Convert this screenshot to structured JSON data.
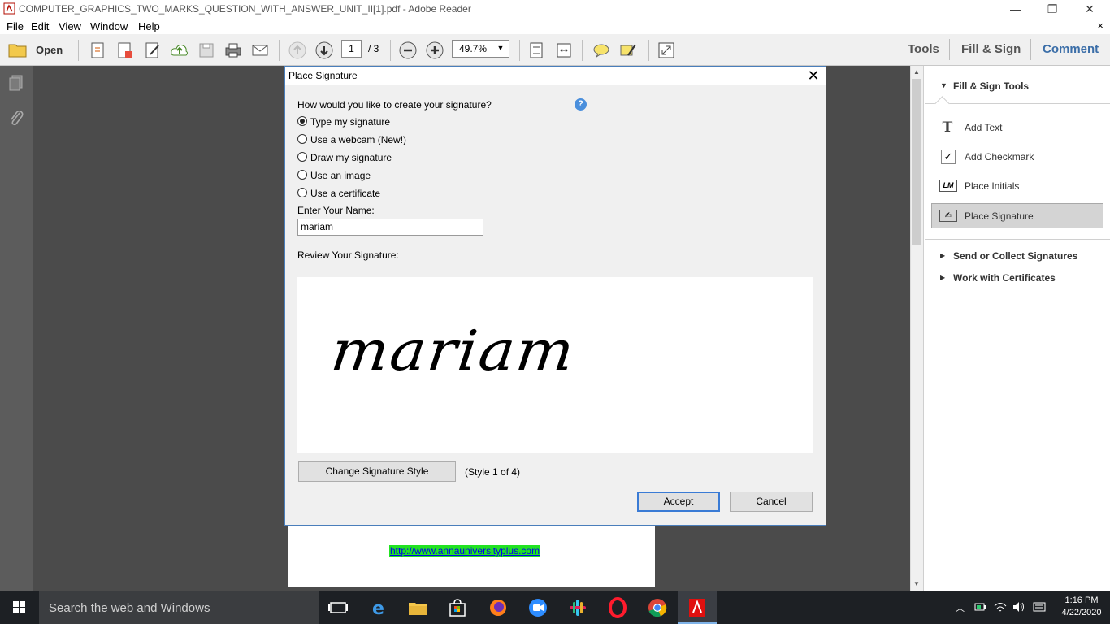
{
  "window": {
    "title": "COMPUTER_GRAPHICS_TWO_MARKS_QUESTION_WITH_ANSWER_UNIT_II[1].pdf - Adobe Reader",
    "minimize": "—",
    "restore": "❐",
    "close": "✕"
  },
  "menu": {
    "items": [
      "File",
      "Edit",
      "View",
      "Window",
      "Help"
    ],
    "close": "×"
  },
  "toolbar": {
    "open_label": "Open",
    "page_current": "1",
    "page_total": "/ 3",
    "zoom": "49.7%",
    "tabs": [
      "Tools",
      "Fill & Sign",
      "Comment"
    ]
  },
  "document": {
    "link": "http://www.annauniversityplus.com"
  },
  "right_panel": {
    "section_title": "Fill & Sign Tools",
    "items": [
      {
        "label": "Add Text",
        "icon": "T"
      },
      {
        "label": "Add Checkmark",
        "icon": "✓"
      },
      {
        "label": "Place Initials",
        "icon": "LM"
      },
      {
        "label": "Place Signature",
        "icon": "✍"
      }
    ],
    "collapsed_sections": [
      "Send or Collect Signatures",
      "Work with Certificates"
    ]
  },
  "dialog": {
    "title": "Place Signature",
    "question": "How would you like to create your signature?",
    "options": [
      {
        "label": "Type my signature",
        "selected": true
      },
      {
        "label": "Use a webcam (New!)",
        "selected": false
      },
      {
        "label": "Draw my signature",
        "selected": false
      },
      {
        "label": "Use an image",
        "selected": false
      },
      {
        "label": "Use a certificate",
        "selected": false
      }
    ],
    "name_label": "Enter Your Name:",
    "name_value": "mariam",
    "review_label": "Review Your Signature:",
    "signature_preview": "mariam",
    "change_style_button": "Change Signature Style",
    "style_status": "(Style 1 of 4)",
    "accept_button": "Accept",
    "cancel_button": "Cancel",
    "help_icon": "?"
  },
  "taskbar": {
    "search_placeholder": "Search the web and Windows",
    "time": "1:16 PM",
    "date": "4/22/2020"
  }
}
